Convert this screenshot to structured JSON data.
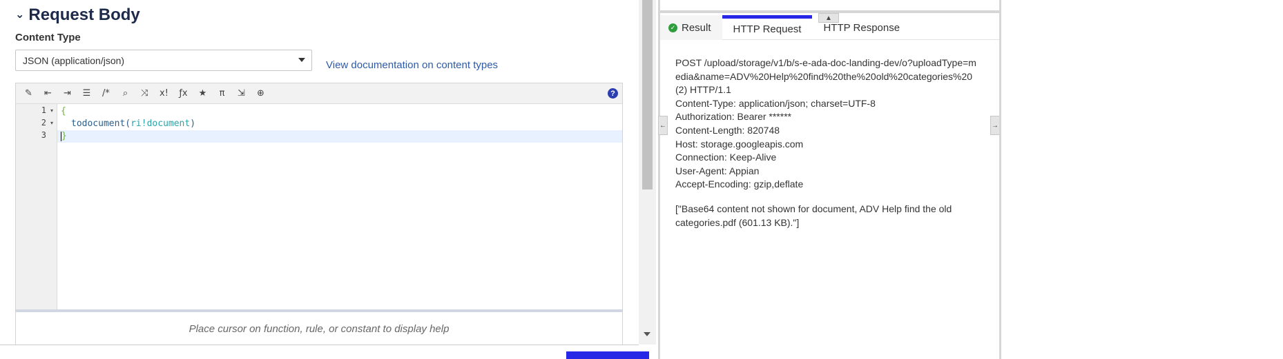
{
  "request_body": {
    "title": "Request Body",
    "content_type_label": "Content Type",
    "content_type_value": "JSON (application/json)",
    "doc_link": "View documentation on content types",
    "toolbar_icons": [
      "magic-wand-icon",
      "outdent-icon",
      "indent-icon",
      "list-icon",
      "comment-icon",
      "search-icon",
      "shuffle-icon",
      "x-exclaim-icon",
      "function-icon",
      "star-icon",
      "pi-icon",
      "export-icon",
      "globe-icon"
    ],
    "line_numbers": [
      "1",
      "2",
      "3"
    ],
    "code": {
      "line1": "{",
      "line2_fn": "todocument",
      "line2_open": "(",
      "line2_arg": "ri!document",
      "line2_close": ")",
      "line3": "}"
    },
    "hint": "Place cursor on function, rule, or constant to display help"
  },
  "result_panel": {
    "tabs": [
      "Result",
      "HTTP Request",
      "HTTP Response"
    ],
    "active_tab": "HTTP Request",
    "request_lines": [
      "POST /upload/storage/v1/b/s-e-ada-doc-landing-dev/o?uploadType=media&name=ADV%20Help%20find%20the%20old%20categories%20(2) HTTP/1.1",
      "Content-Type: application/json; charset=UTF-8",
      "Authorization: Bearer ******",
      "Content-Length: 820748",
      "Host: storage.googleapis.com",
      "Connection: Keep-Alive",
      "User-Agent: Appian",
      "Accept-Encoding: gzip,deflate"
    ],
    "body": "[\"Base64 content not shown for document, ADV Help find the old categories.pdf (601.13 KB).\"]"
  },
  "colors": {
    "accent": "#2727e6",
    "link": "#2d5aa8",
    "success": "#2e9e3c"
  }
}
